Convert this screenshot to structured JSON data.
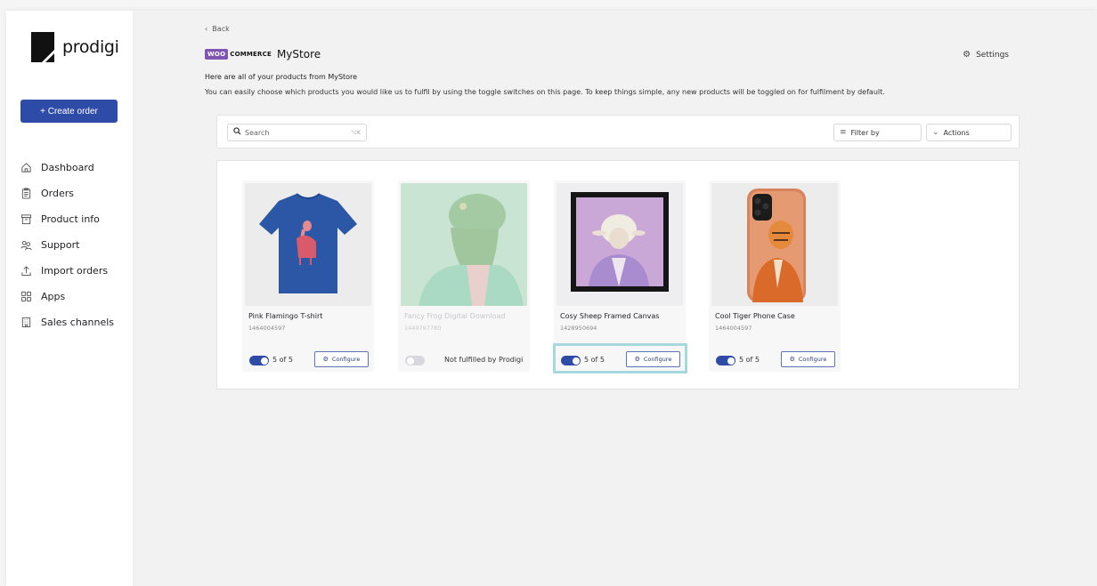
{
  "brand": {
    "name": "prodigi"
  },
  "sidebar": {
    "create_label": "+ Create order",
    "items": [
      {
        "label": "Dashboard",
        "icon": "home-icon"
      },
      {
        "label": "Orders",
        "icon": "clipboard-icon"
      },
      {
        "label": "Product info",
        "icon": "box-icon"
      },
      {
        "label": "Support",
        "icon": "people-icon"
      },
      {
        "label": "Import orders",
        "icon": "upload-icon"
      },
      {
        "label": "Apps",
        "icon": "grid-icon"
      },
      {
        "label": "Sales channels",
        "icon": "building-icon"
      }
    ]
  },
  "header": {
    "back_label": "Back",
    "woo_badge": "WOO",
    "commerce_text": "COMMERCE",
    "store_name": "MyStore",
    "settings_label": "Settings",
    "intro_line1": "Here are all of your products from MyStore",
    "intro_line2": "You can easily choose which products you would like us to fulfil by using the toggle switches on this page. To keep things simple, any new products will be toggled on for fulfilment by default."
  },
  "toolbar": {
    "search_placeholder": "Search",
    "search_shortcut": "⌥K",
    "filter_label": "Filter by",
    "actions_label": "Actions"
  },
  "products": [
    {
      "title": "Pink Flamingo T-shirt",
      "sku": "1464004597",
      "enabled": true,
      "count": "5 of 5",
      "configure": "Configure"
    },
    {
      "title": "Fancy Frog Digital Download",
      "sku": "1449797780",
      "enabled": false,
      "status": "Not fulfilled by Prodigi"
    },
    {
      "title": "Cosy Sheep Framed Canvas",
      "sku": "1428950694",
      "enabled": true,
      "count": "5 of 5",
      "configure": "Configure",
      "highlighted": true
    },
    {
      "title": "Cool Tiger Phone Case",
      "sku": "1464004597",
      "enabled": true,
      "count": "5 of 5",
      "configure": "Configure"
    }
  ],
  "colors": {
    "primary": "#2f4ba8",
    "woo_purple": "#7f54b3",
    "highlight": "#a6d9dd"
  }
}
